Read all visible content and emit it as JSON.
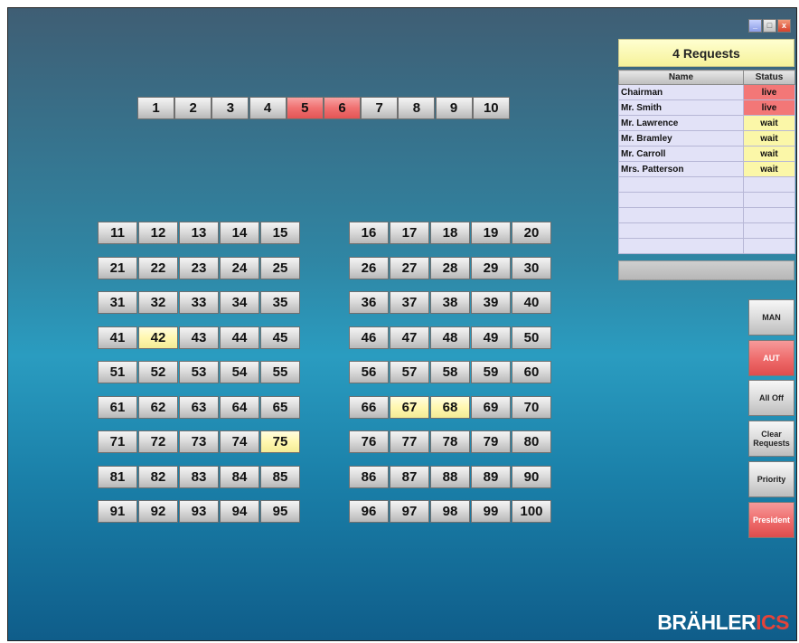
{
  "window_controls": {
    "minimize": "_",
    "maximize": "□",
    "close": "x"
  },
  "top_row": [
    {
      "label": "1",
      "state": "off"
    },
    {
      "label": "2",
      "state": "off"
    },
    {
      "label": "3",
      "state": "off"
    },
    {
      "label": "4",
      "state": "off"
    },
    {
      "label": "5",
      "state": "live"
    },
    {
      "label": "6",
      "state": "live"
    },
    {
      "label": "7",
      "state": "off"
    },
    {
      "label": "8",
      "state": "off"
    },
    {
      "label": "9",
      "state": "off"
    },
    {
      "label": "10",
      "state": "off"
    }
  ],
  "grid_rows": [
    [
      [
        "11",
        "off"
      ],
      [
        "12",
        "off"
      ],
      [
        "13",
        "off"
      ],
      [
        "14",
        "off"
      ],
      [
        "15",
        "off"
      ],
      [
        "16",
        "off"
      ],
      [
        "17",
        "off"
      ],
      [
        "18",
        "off"
      ],
      [
        "19",
        "off"
      ],
      [
        "20",
        "off"
      ]
    ],
    [
      [
        "21",
        "off"
      ],
      [
        "22",
        "off"
      ],
      [
        "23",
        "off"
      ],
      [
        "24",
        "off"
      ],
      [
        "25",
        "off"
      ],
      [
        "26",
        "off"
      ],
      [
        "27",
        "off"
      ],
      [
        "28",
        "off"
      ],
      [
        "29",
        "off"
      ],
      [
        "30",
        "off"
      ]
    ],
    [
      [
        "31",
        "off"
      ],
      [
        "32",
        "off"
      ],
      [
        "33",
        "off"
      ],
      [
        "34",
        "off"
      ],
      [
        "35",
        "off"
      ],
      [
        "36",
        "off"
      ],
      [
        "37",
        "off"
      ],
      [
        "38",
        "off"
      ],
      [
        "39",
        "off"
      ],
      [
        "40",
        "off"
      ]
    ],
    [
      [
        "41",
        "off"
      ],
      [
        "42",
        "wait"
      ],
      [
        "43",
        "off"
      ],
      [
        "44",
        "off"
      ],
      [
        "45",
        "off"
      ],
      [
        "46",
        "off"
      ],
      [
        "47",
        "off"
      ],
      [
        "48",
        "off"
      ],
      [
        "49",
        "off"
      ],
      [
        "50",
        "off"
      ]
    ],
    [
      [
        "51",
        "off"
      ],
      [
        "52",
        "off"
      ],
      [
        "53",
        "off"
      ],
      [
        "54",
        "off"
      ],
      [
        "55",
        "off"
      ],
      [
        "56",
        "off"
      ],
      [
        "57",
        "off"
      ],
      [
        "58",
        "off"
      ],
      [
        "59",
        "off"
      ],
      [
        "60",
        "off"
      ]
    ],
    [
      [
        "61",
        "off"
      ],
      [
        "62",
        "off"
      ],
      [
        "63",
        "off"
      ],
      [
        "64",
        "off"
      ],
      [
        "65",
        "off"
      ],
      [
        "66",
        "off"
      ],
      [
        "67",
        "wait"
      ],
      [
        "68",
        "wait"
      ],
      [
        "69",
        "off"
      ],
      [
        "70",
        "off"
      ]
    ],
    [
      [
        "71",
        "off"
      ],
      [
        "72",
        "off"
      ],
      [
        "73",
        "off"
      ],
      [
        "74",
        "off"
      ],
      [
        "75",
        "wait"
      ],
      [
        "76",
        "off"
      ],
      [
        "77",
        "off"
      ],
      [
        "78",
        "off"
      ],
      [
        "79",
        "off"
      ],
      [
        "80",
        "off"
      ]
    ],
    [
      [
        "81",
        "off"
      ],
      [
        "82",
        "off"
      ],
      [
        "83",
        "off"
      ],
      [
        "84",
        "off"
      ],
      [
        "85",
        "off"
      ],
      [
        "86",
        "off"
      ],
      [
        "87",
        "off"
      ],
      [
        "88",
        "off"
      ],
      [
        "89",
        "off"
      ],
      [
        "90",
        "off"
      ]
    ],
    [
      [
        "91",
        "off"
      ],
      [
        "92",
        "off"
      ],
      [
        "93",
        "off"
      ],
      [
        "94",
        "off"
      ],
      [
        "95",
        "off"
      ],
      [
        "96",
        "off"
      ],
      [
        "97",
        "off"
      ],
      [
        "98",
        "off"
      ],
      [
        "99",
        "off"
      ],
      [
        "100",
        "off"
      ]
    ]
  ],
  "requests": {
    "header": "4 Requests",
    "col_name": "Name",
    "col_status": "Status",
    "rows": [
      {
        "name": "Chairman",
        "status": "live"
      },
      {
        "name": "Mr. Smith",
        "status": "live"
      },
      {
        "name": "Mr. Lawrence",
        "status": "wait"
      },
      {
        "name": "Mr. Bramley",
        "status": "wait"
      },
      {
        "name": "Mr. Carroll",
        "status": "wait"
      },
      {
        "name": "Mrs. Patterson",
        "status": "wait"
      },
      {
        "name": "",
        "status": ""
      },
      {
        "name": "",
        "status": ""
      },
      {
        "name": "",
        "status": ""
      },
      {
        "name": "",
        "status": ""
      },
      {
        "name": "",
        "status": ""
      }
    ]
  },
  "controls": [
    {
      "label": "MAN",
      "active": false
    },
    {
      "label": "AUT",
      "active": true
    },
    {
      "label": "All Off",
      "active": false
    },
    {
      "label": "Clear\nRequests",
      "active": false
    },
    {
      "label": "Priority",
      "active": false
    },
    {
      "label": "President",
      "active": true
    }
  ],
  "logo": {
    "part1": "BRÄHLER",
    "part2": "ICS"
  },
  "colors": {
    "live": "#f07070",
    "wait": "#fff7b0",
    "header_yellow": "#f6f29a",
    "brand_red": "#e4433a"
  }
}
